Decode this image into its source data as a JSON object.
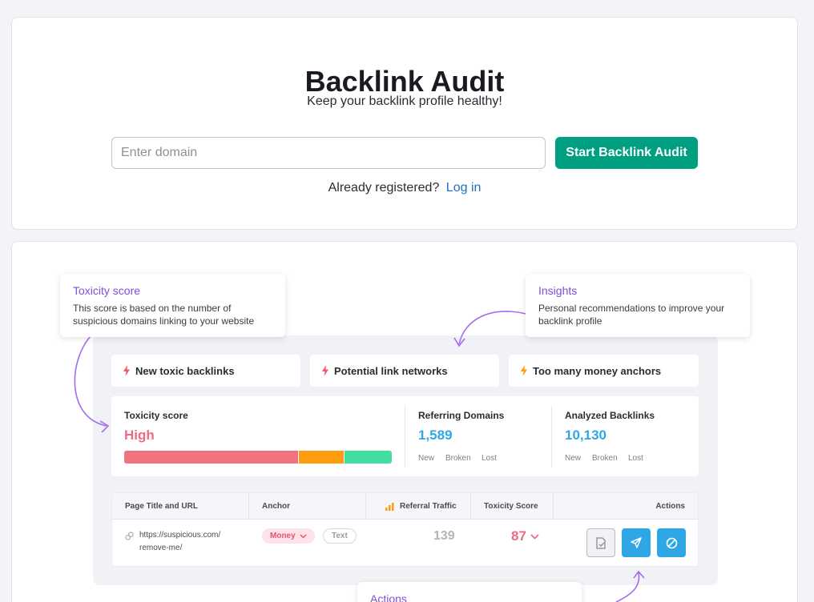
{
  "hero": {
    "title": "Backlink Audit",
    "subtitle": "Keep your backlink profile healthy!",
    "input_placeholder": "Enter domain",
    "start_button": "Start Backlink Audit",
    "registered_text": "Already registered?",
    "login_link": "Log in"
  },
  "callouts": {
    "toxicity": {
      "title": "Toxicity score",
      "text": "This score is based on the number of suspicious domains linking to your website"
    },
    "insights": {
      "title": "Insights",
      "text": "Personal recommendations to improve your backlink profile"
    },
    "actions": {
      "title": "Actions"
    }
  },
  "issues": [
    {
      "label": "New toxic backlinks",
      "color": "#f0566e"
    },
    {
      "label": "Potential link networks",
      "color": "#f0566e"
    },
    {
      "label": "Too many money anchors",
      "color": "#ff9b0f"
    }
  ],
  "scores": {
    "toxicity": {
      "label": "Toxicity score",
      "value": "High",
      "color": "#ef6b81"
    },
    "bar_segments": [
      {
        "level": "high",
        "share": 0.65,
        "color": "#f1717f"
      },
      {
        "level": "medium",
        "share": 0.17,
        "color": "#ff9b0f"
      },
      {
        "level": "low",
        "share": 0.18,
        "color": "#42dda0"
      }
    ],
    "referring": {
      "label": "Referring Domains",
      "value": "1,589",
      "sub": [
        "New",
        "Broken",
        "Lost"
      ]
    },
    "analyzed": {
      "label": "Analyzed Backlinks",
      "value": "10,130",
      "sub": [
        "New",
        "Broken",
        "Lost"
      ]
    }
  },
  "table": {
    "headers": {
      "page": "Page Title and URL",
      "anchor": "Anchor",
      "traffic": "Referral Traffic",
      "toxicity": "Toxicity Score",
      "actions": "Actions"
    },
    "row": {
      "url_line1": "https://suspicious.com/",
      "url_line2": "remove-me/",
      "anchor_money": "Money",
      "anchor_text": "Text",
      "traffic": "139",
      "toxicity": "87"
    },
    "actions": [
      "export-icon",
      "send-icon",
      "block-icon"
    ]
  },
  "colors": {
    "primary": "#009f81",
    "accent_purple": "#7c4fd6",
    "blue": "#2fa7e7",
    "toxic": "#ef6b81"
  }
}
